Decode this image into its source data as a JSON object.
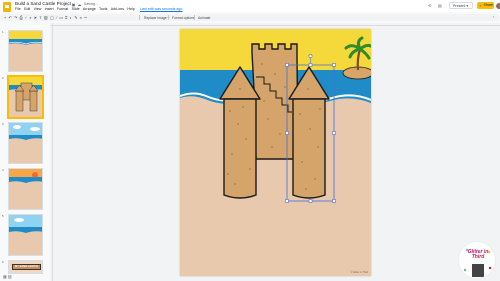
{
  "header": {
    "doc_title": "Build a Sand Castle Project",
    "saving_status": "Saving...",
    "last_edit": "Last edit was seconds ago",
    "menu": [
      "File",
      "Edit",
      "View",
      "Insert",
      "Format",
      "Slide",
      "Arrange",
      "Tools",
      "Add-ons",
      "Help"
    ],
    "present_label": "Present",
    "share_label": "Share"
  },
  "toolbar": {
    "replace_image": "Replace image",
    "format_options": "Format options",
    "animate": "Animate"
  },
  "filmstrip": {
    "slides": [
      {
        "num": "1",
        "active": false
      },
      {
        "num": "2",
        "active": true
      },
      {
        "num": "3",
        "active": false
      },
      {
        "num": "4",
        "active": false
      },
      {
        "num": "5",
        "active": false
      },
      {
        "num": "6",
        "active": false
      }
    ],
    "last_thumb_label": "MY SAND CASTLE"
  },
  "slide": {
    "footer": "© Glitter in Third"
  },
  "watermark": {
    "text": "Glitter in Third"
  },
  "colors": {
    "sky_yellow": "#f5d83a",
    "sea_blue": "#1f8cc8",
    "sand": "#e8c9ad",
    "castle": "#d4a46a",
    "selection": "#4a6fd8",
    "share_yellow": "#fbbc04"
  }
}
